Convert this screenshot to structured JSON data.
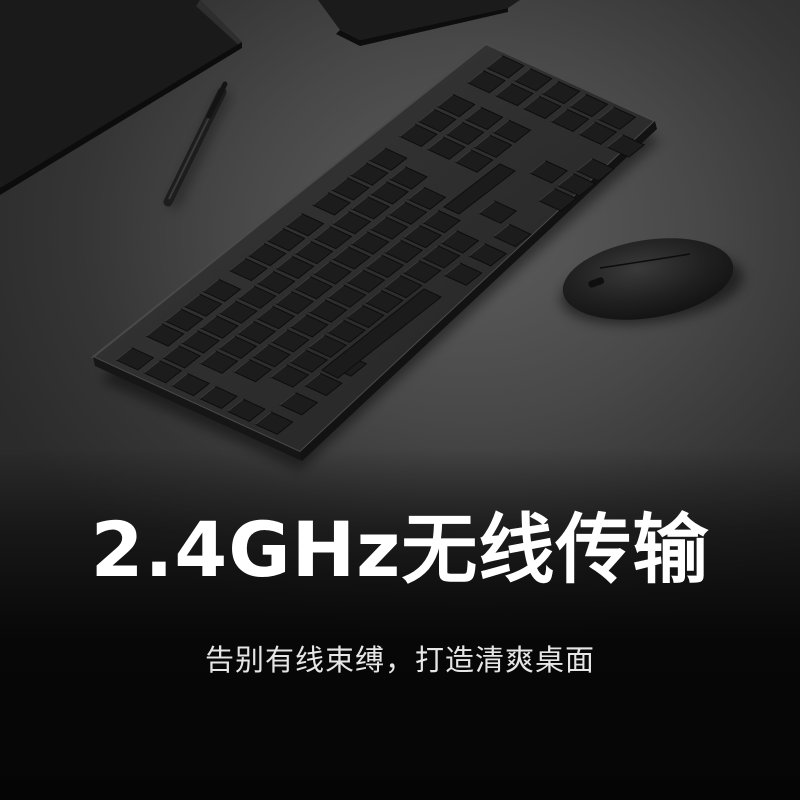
{
  "headline": "2.4GHz无线传输",
  "subline": "告别有线束缚，打造清爽桌面",
  "colors": {
    "desk": "#484848",
    "keyboard_body": "#2a2a2a",
    "key": "#1c1c1c",
    "mouse": "#1e1e1e",
    "text": "#ffffff"
  },
  "objects": [
    "monitor-stand",
    "pen",
    "keyboard",
    "mouse"
  ]
}
